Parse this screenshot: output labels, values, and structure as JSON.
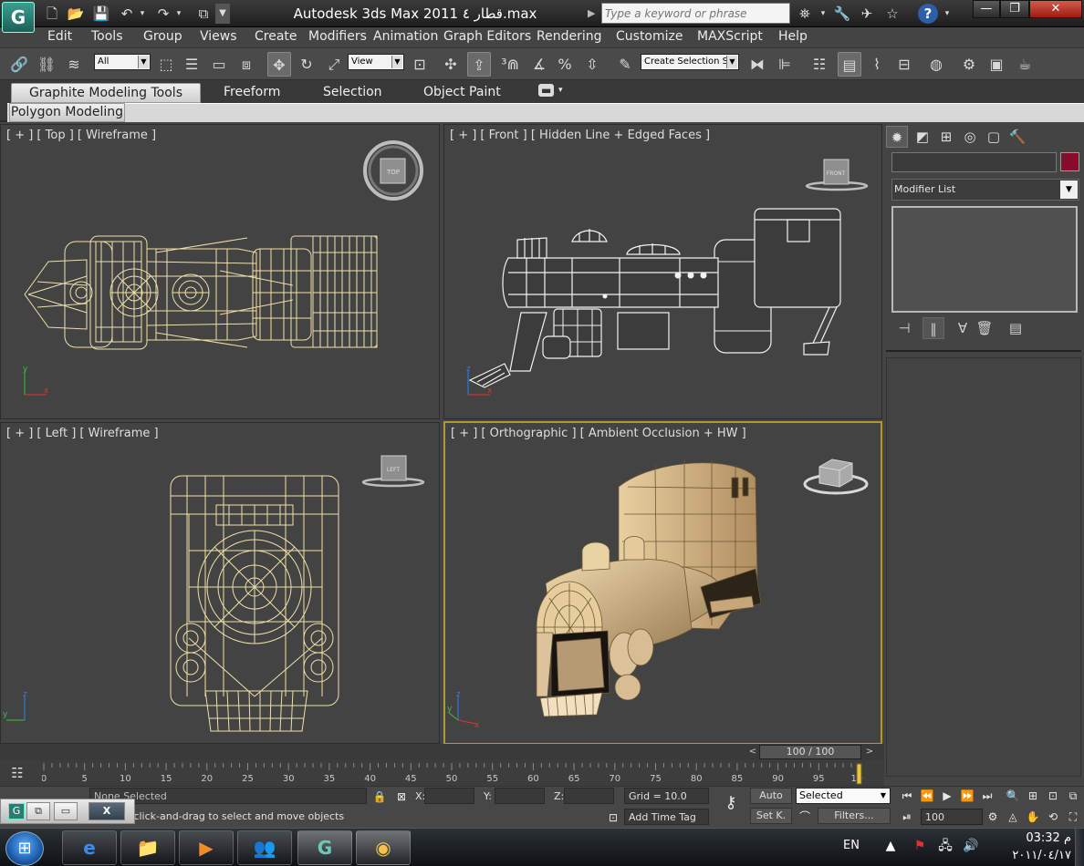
{
  "app": {
    "logo": "G",
    "title": "Autodesk 3ds Max  2011",
    "filename": "قطار ٤.max",
    "search_placeholder": "Type a keyword or phrase"
  },
  "window_buttons": {
    "minimize": "—",
    "maximize": "❐",
    "close": "✕"
  },
  "menu": [
    "Edit",
    "Tools",
    "Group",
    "Views",
    "Create",
    "Modifiers",
    "Animation",
    "Graph Editors",
    "Rendering",
    "Customize",
    "MAXScript",
    "Help"
  ],
  "toolbar": {
    "selection_filter": "All",
    "reference_coord": "View",
    "named_selection_placeholder": "Create Selection S"
  },
  "ribbon": {
    "tabs": [
      "Graphite Modeling Tools",
      "Freeform",
      "Selection",
      "Object Paint"
    ],
    "active_tab": "Graphite Modeling Tools",
    "subtab": "Polygon Modeling"
  },
  "viewports": {
    "top": {
      "label": "[ + ] [ Top ] [ Wireframe ]",
      "cube_label": "TOP"
    },
    "front": {
      "label": "[ + ] [ Front ] [ Hidden Line + Edged Faces ]",
      "cube_label": "FRONT"
    },
    "left": {
      "label": "[ + ] [ Left ] [ Wireframe ]",
      "cube_label": "LEFT"
    },
    "ortho": {
      "label": "[ + ] [ Orthographic ] [ Ambient Occlusion + HW ]",
      "active": true
    }
  },
  "axis_labels": {
    "x": "x",
    "y": "y",
    "z": "z"
  },
  "command_panel": {
    "modifier_list": "Modifier List",
    "object_color": "#8a0c2c"
  },
  "time_slider": {
    "label": "100 / 100",
    "prev": "<",
    "next": ">",
    "current_frame": 100,
    "total_frames": 100,
    "ticks": [
      "0",
      "5",
      "10",
      "15",
      "20",
      "25",
      "30",
      "35",
      "40",
      "45",
      "50",
      "55",
      "60",
      "65",
      "70",
      "75",
      "80",
      "85",
      "90",
      "95",
      "100"
    ]
  },
  "status": {
    "selection": "None Selected",
    "prompt": "Click or click-and-drag to select and move objects",
    "x_label": "X:",
    "y_label": "Y:",
    "z_label": "Z:",
    "grid": "Grid = 10.0",
    "add_time_tag": "Add Time Tag",
    "auto_key": "Auto",
    "set_key": "Set K.",
    "key_mode": "Selected",
    "filters": "Filters...",
    "frame_value": "100"
  },
  "mini_window": {
    "logo": "G",
    "close": "X"
  },
  "taskbar": {
    "language": "EN",
    "time": "03:32 م",
    "date": "٢٠١١/٠٤/١٧"
  },
  "colors": {
    "wire": "#efe0a8",
    "viewport_bg": "#434343",
    "active_border": "#b99530",
    "model_fill": "#d8b887"
  }
}
